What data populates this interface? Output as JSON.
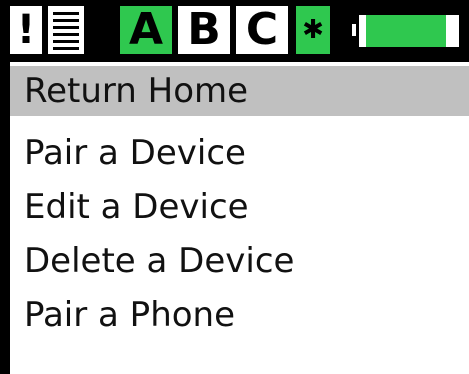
{
  "status_bar": {
    "alert_glyph": "!",
    "menu_icon": "menu-lines-icon",
    "slots": [
      "A",
      "B",
      "C"
    ],
    "active_slot": "A",
    "bluetooth_glyph": "✱",
    "bluetooth_icon": "bluetooth-icon",
    "battery_icon": "battery-icon",
    "battery_level": 0.86
  },
  "colors": {
    "accent_green": "#2fc84f",
    "selection_gray": "#c0c0c0",
    "frame_black": "#000000"
  },
  "menu": {
    "items": [
      {
        "label": "Return Home",
        "selected": true
      },
      {
        "label": "Pair a Device",
        "selected": false
      },
      {
        "label": "Edit a Device",
        "selected": false
      },
      {
        "label": "Delete a Device",
        "selected": false
      },
      {
        "label": "Pair a Phone",
        "selected": false
      }
    ]
  }
}
